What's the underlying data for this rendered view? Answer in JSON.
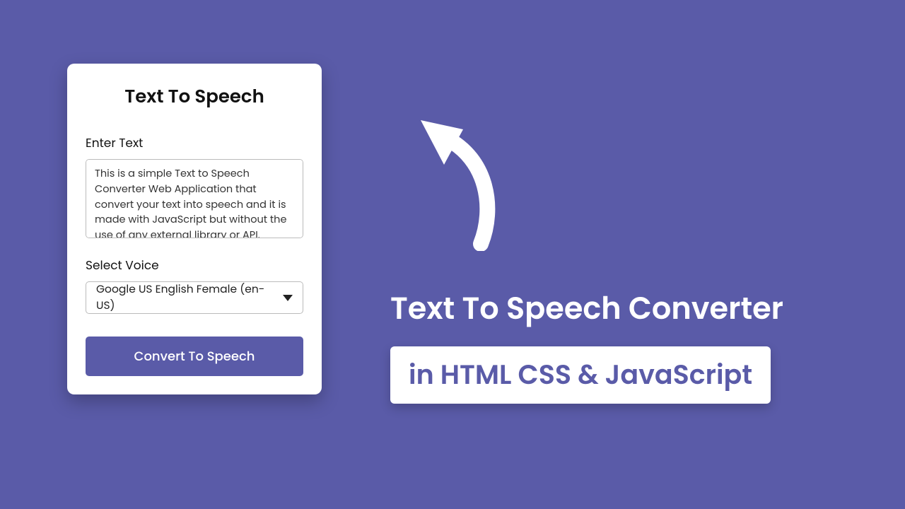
{
  "card": {
    "title": "Text To Speech",
    "enter_text_label": "Enter Text",
    "textarea_value": "This is a simple Text to Speech Converter Web Application that convert your text into speech and it is made with JavaScript but without the use of any external library or API.",
    "select_voice_label": "Select Voice",
    "selected_voice": "Google US English Female (en-US)",
    "convert_label": "Convert To Speech"
  },
  "promo": {
    "headline": "Text To Speech Converter",
    "badge": "in HTML CSS & JavaScript"
  },
  "colors": {
    "accent": "#5a5ba8"
  }
}
